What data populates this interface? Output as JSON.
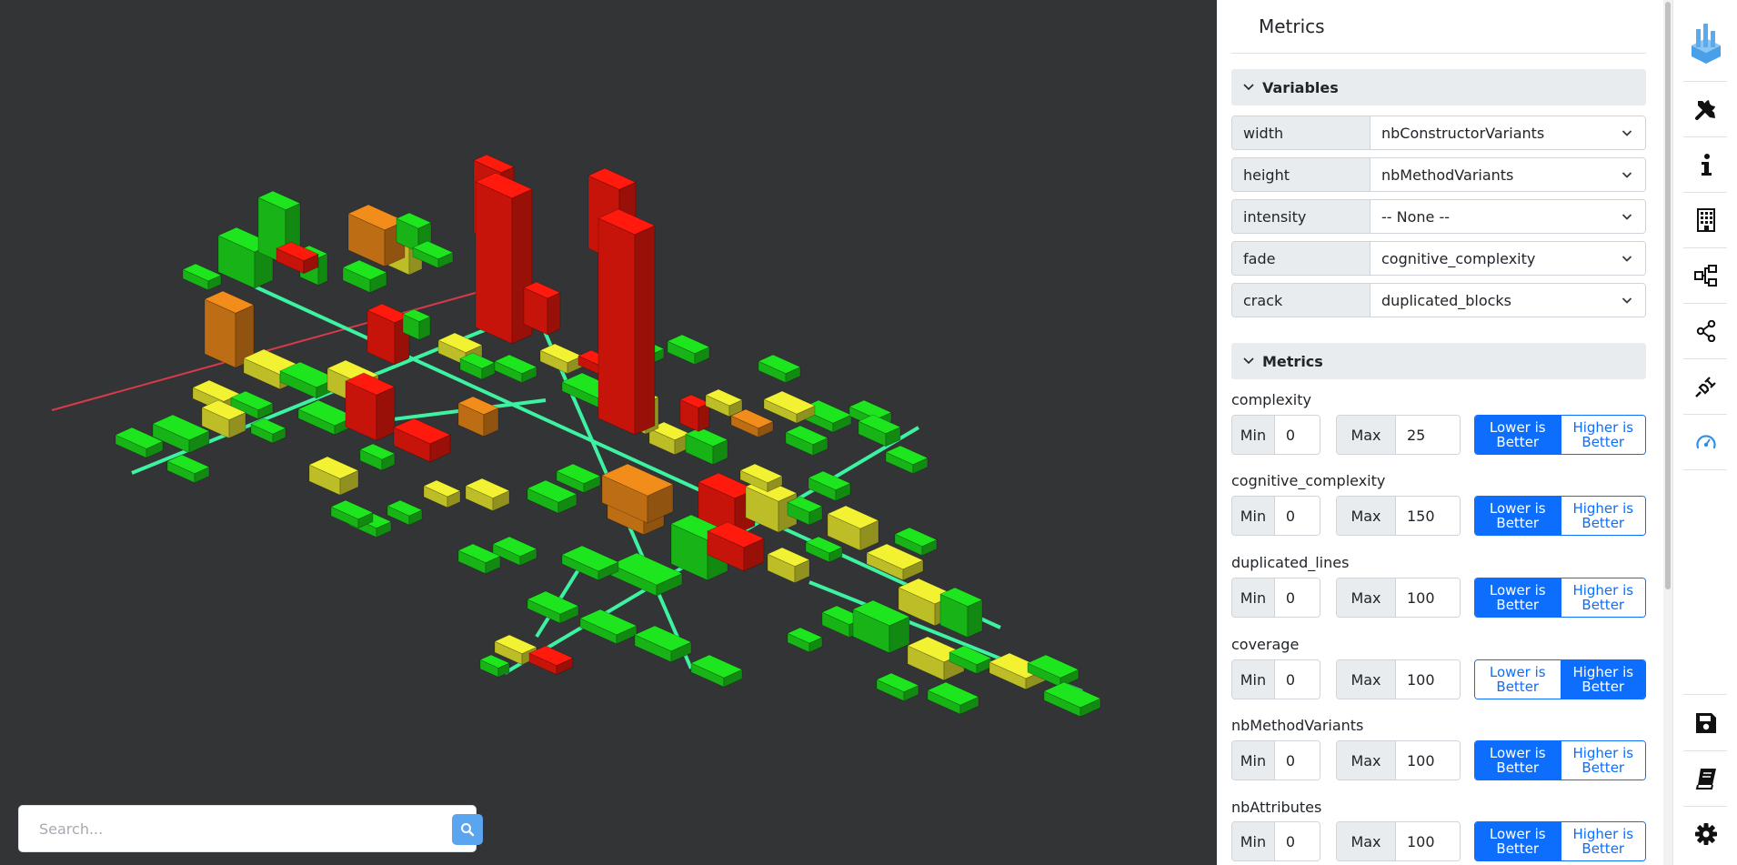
{
  "search": {
    "placeholder": "Search..."
  },
  "panel": {
    "title": "Metrics",
    "variables_header": "Variables",
    "variables": [
      {
        "label": "width",
        "value": "nbConstructorVariants"
      },
      {
        "label": "height",
        "value": "nbMethodVariants"
      },
      {
        "label": "intensity",
        "value": "-- None --"
      },
      {
        "label": "fade",
        "value": "cognitive_complexity"
      },
      {
        "label": "crack",
        "value": "duplicated_blocks"
      }
    ],
    "metrics_header": "Metrics",
    "min_label": "Min",
    "max_label": "Max",
    "lower_label": "Lower is Better",
    "higher_label": "Higher is Better",
    "metrics": [
      {
        "name": "complexity",
        "min": "0",
        "max": "25",
        "better": "lower"
      },
      {
        "name": "cognitive_complexity",
        "min": "0",
        "max": "150",
        "better": "lower"
      },
      {
        "name": "duplicated_lines",
        "min": "0",
        "max": "100",
        "better": "lower"
      },
      {
        "name": "coverage",
        "min": "0",
        "max": "100",
        "better": "higher"
      },
      {
        "name": "nbMethodVariants",
        "min": "0",
        "max": "100",
        "better": "lower"
      },
      {
        "name": "nbAttributes",
        "min": "0",
        "max": "100",
        "better": "lower"
      }
    ]
  },
  "iconbar": {
    "top": [
      "logo-icon",
      "tools-icon",
      "info-icon",
      "building-icon",
      "hierarchy-icon",
      "share-icon",
      "plug-icon",
      "gauge-icon"
    ],
    "bottom": [
      "save-icon",
      "book-icon",
      "gear-icon"
    ]
  },
  "colors": {
    "viewport_bg": "#333436",
    "accent": "#0d6efd",
    "building_green": "#1ee61e",
    "building_yellow": "#f2f233",
    "building_orange": "#f28c1a",
    "building_red": "#ff1a0d",
    "street": "#3df2a0"
  }
}
